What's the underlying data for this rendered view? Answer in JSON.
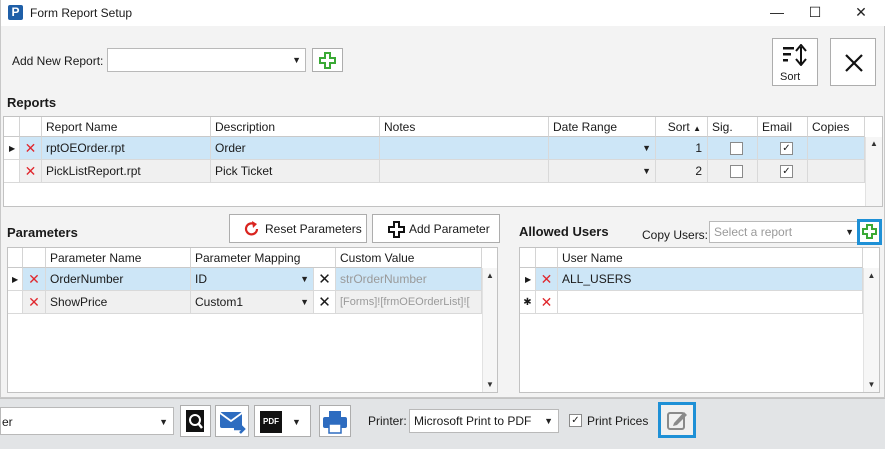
{
  "window": {
    "title": "Form Report Setup",
    "logo": "P"
  },
  "toolbar": {
    "add_new_report_label": "Add New Report:",
    "add_new_report_value": "",
    "sort_label": "Sort"
  },
  "reports": {
    "title": "Reports",
    "columns": [
      "Report Name",
      "Description",
      "Notes",
      "Date Range",
      "Sort",
      "Sig.",
      "Email",
      "Copies"
    ],
    "rows": [
      {
        "name": "rptOEOrder.rpt",
        "description": "Order",
        "notes": "",
        "date_range": "",
        "sort": "1",
        "sig": false,
        "email": true,
        "copies": ""
      },
      {
        "name": "PickListReport.rpt",
        "description": "Pick Ticket",
        "notes": "",
        "date_range": "",
        "sort": "2",
        "sig": false,
        "email": true,
        "copies": ""
      }
    ]
  },
  "parameters": {
    "title": "Parameters",
    "reset_label": "Reset Parameters",
    "add_label": "Add Parameter",
    "columns": [
      "Parameter Name",
      "Parameter Mapping",
      "Custom Value"
    ],
    "rows": [
      {
        "name": "OrderNumber",
        "mapping": "ID",
        "custom": "strOrderNumber"
      },
      {
        "name": "ShowPrice",
        "mapping": "Custom1",
        "custom": "[Forms]![frmOEOrderList]!["
      }
    ]
  },
  "allowed_users": {
    "title": "Allowed Users",
    "copy_users_label": "Copy Users:",
    "copy_users_placeholder": "Select a report",
    "columns": [
      "User Name"
    ],
    "rows": [
      {
        "name": "ALL_USERS"
      },
      {
        "name": ""
      }
    ]
  },
  "footer": {
    "left_select_text": "er",
    "pdf_label": "PDF",
    "printer_label": "Printer:",
    "printer_value": "Microsoft Print to PDF",
    "print_prices_label": "Print Prices",
    "print_prices_checked": true
  },
  "colors": {
    "accent": "#1e90d6",
    "delete": "#e0282e",
    "add": "#3aa935",
    "selected_row": "#cde6f7"
  }
}
